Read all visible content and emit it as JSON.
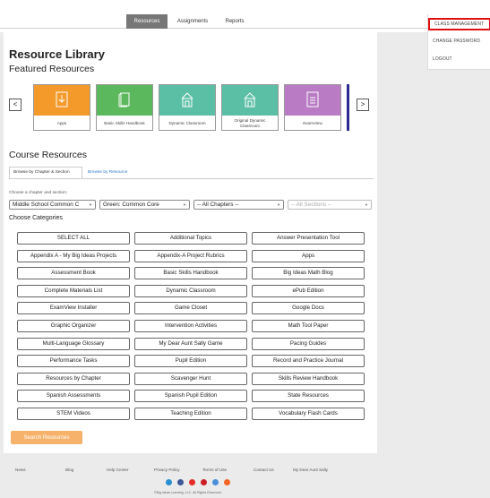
{
  "nav": {
    "tabs": [
      {
        "label": "Resources",
        "active": true
      },
      {
        "label": "Assignments",
        "active": false
      },
      {
        "label": "Reports",
        "active": false
      }
    ]
  },
  "user_menu": {
    "items": [
      {
        "label": "CLASS MANAGEMENT",
        "highlighted": true
      },
      {
        "label": "CHANGE PASSWORD",
        "highlighted": false
      },
      {
        "label": "LOGOUT",
        "highlighted": false
      }
    ]
  },
  "library": {
    "title": "Resource Library",
    "featured_title": "Featured Resources",
    "prev_label": "<",
    "next_label": ">",
    "featured": [
      {
        "label": "Apps",
        "color": "#f39a2b",
        "icon": "download-file-icon"
      },
      {
        "label": "Basic Skills Handbook",
        "color": "#5cb85c",
        "icon": "book-icon"
      },
      {
        "label": "Dynamic Classroom",
        "color": "#5bbfa5",
        "icon": "classroom-building-icon"
      },
      {
        "label": "Original Dynamic Classroom",
        "color": "#5bbfa5",
        "icon": "classroom-building-icon"
      },
      {
        "label": "ExamView",
        "color": "#b97bc4",
        "icon": "document-icon"
      }
    ]
  },
  "course": {
    "title": "Course Resources",
    "subtabs": [
      {
        "label": "Browse by Chapter & Section",
        "active": true
      },
      {
        "label": "Browse by Resource",
        "active": false
      }
    ],
    "chooser_label": "Choose a chapter and section:",
    "selects": [
      {
        "value": "Middle School Common C",
        "disabled": false
      },
      {
        "value": "Green: Common Core",
        "disabled": false
      },
      {
        "value": "-- All Chapters --",
        "disabled": false
      },
      {
        "value": "-- All Sections --",
        "disabled": true
      }
    ],
    "categories_title": "Choose Categories",
    "categories": [
      "SELECT ALL",
      "Additional Topics",
      "Answer Presentation Tool",
      "Appendix A - My Big Ideas Projects",
      "Appendix-A Project Rubrics",
      "Apps",
      "Assessment Book",
      "Basic Skills Handbook",
      "Big Ideas Math Blog",
      "Complete Materials List",
      "Dynamic Classroom",
      "ePub Edition",
      "ExamView Installer",
      "Game Closet",
      "Google Docs",
      "Graphic Organizer",
      "Intervention Activities",
      "Math Tool Paper",
      "Multi-Language Glossary",
      "My Dear Aunt Sally Game",
      "Pacing Guides",
      "Performance Tasks",
      "Pupil Edition",
      "Record and Practice Journal",
      "Resources by Chapter",
      "Scavenger Hunt",
      "Skills Review Handbook",
      "Spanish Assessments",
      "Spanish Pupil Edition",
      "State Resources",
      "STEM Videos",
      "Teaching Edition",
      "Vocabulary Flash Cards"
    ],
    "search_label": "Search Resources"
  },
  "footer": {
    "links": [
      "News",
      "Blog",
      "Help Center",
      "Privacy Policy",
      "Terms of Use",
      "Contact Us",
      "My Dear Aunt Sally"
    ],
    "social": [
      {
        "icon": "linkedin-icon",
        "color": "#2a8fd0"
      },
      {
        "icon": "facebook-icon",
        "color": "#3b5998"
      },
      {
        "icon": "youtube-icon",
        "color": "#e52d27"
      },
      {
        "icon": "pinterest-icon",
        "color": "#cb2027"
      },
      {
        "icon": "email-icon",
        "color": "#4a90d9"
      },
      {
        "icon": "rss-icon",
        "color": "#f26522"
      }
    ],
    "copyright": "©Big Ideas Learning, LLC. All Rights Reserved."
  }
}
